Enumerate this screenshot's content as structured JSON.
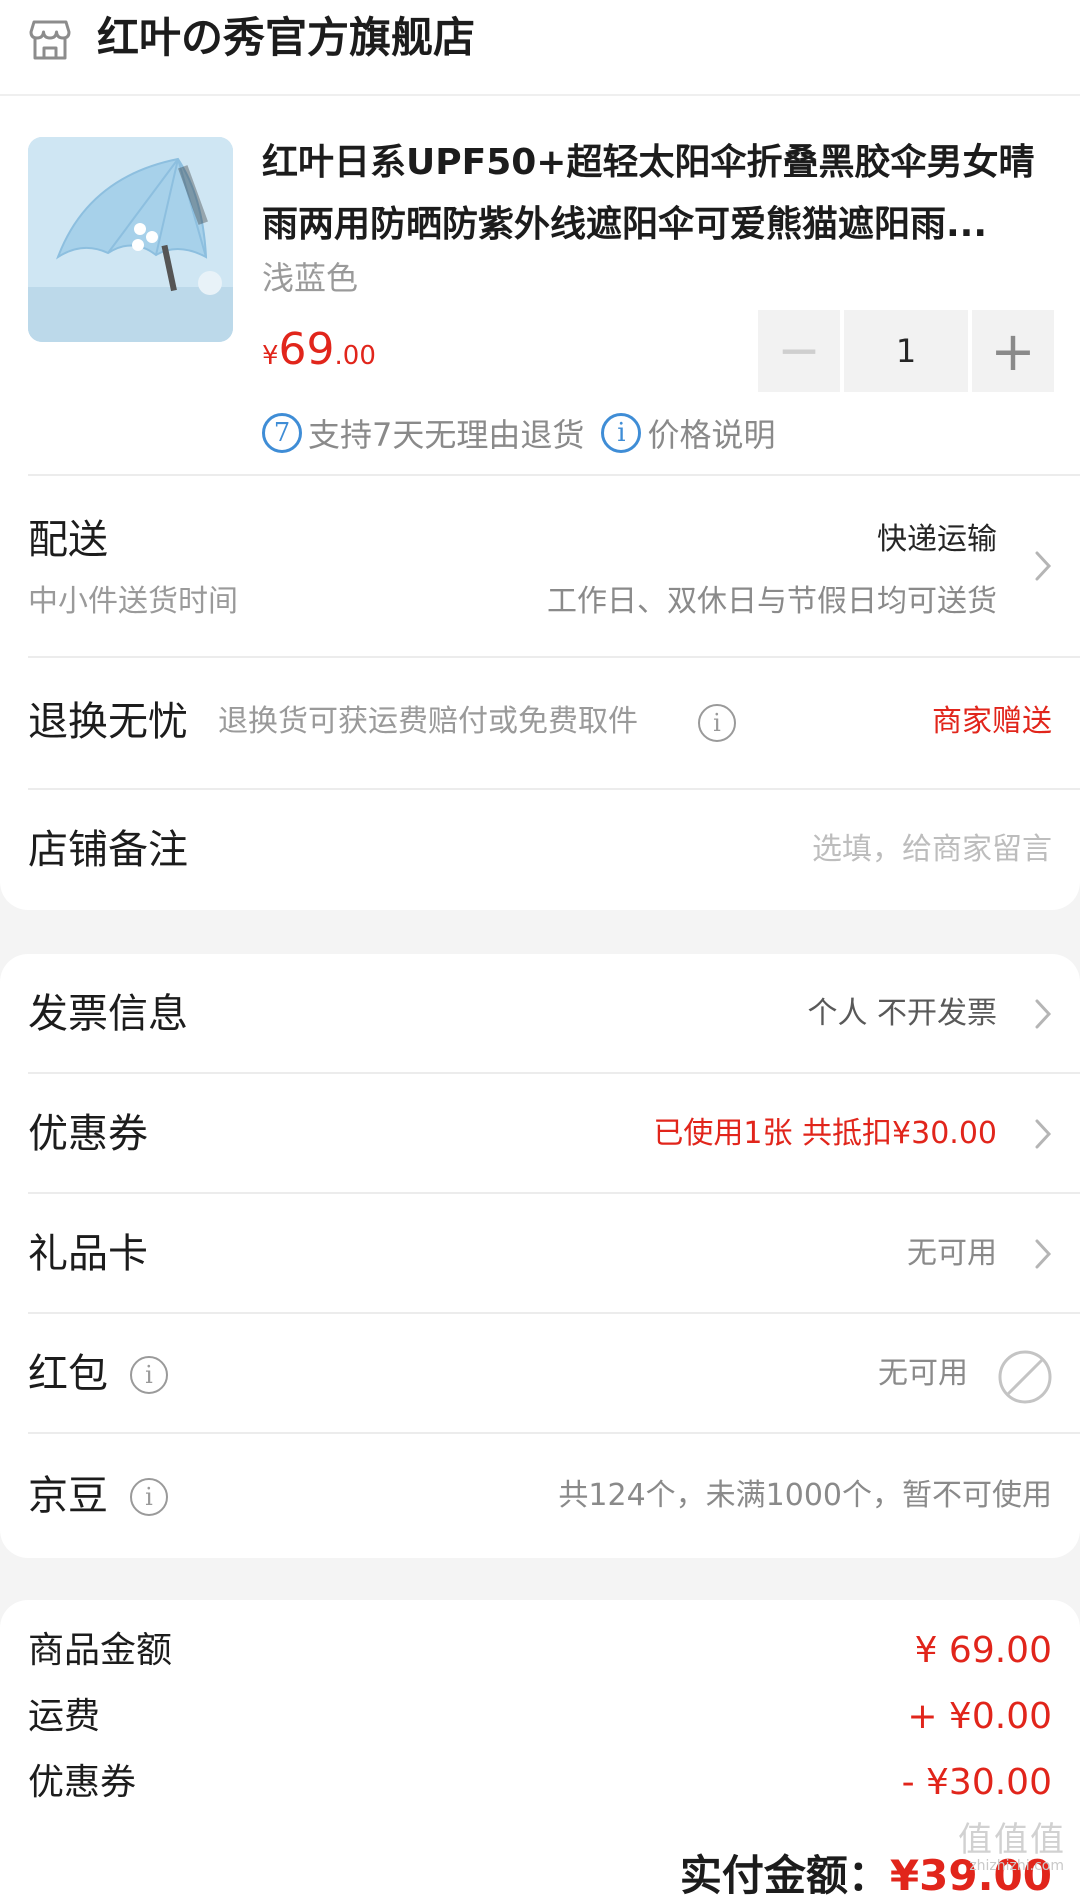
{
  "shop": {
    "name": "红叶の秀官方旗舰店",
    "icon": "store-icon"
  },
  "product": {
    "title_line1": "红叶日系UPF50+超轻太阳伞折叠黑胶伞男女晴",
    "title_line2": "雨两用防晒防紫外线遮阳伞可爱熊猫遮阳雨...",
    "variant": "浅蓝色",
    "price_currency": "¥",
    "price_int": "69",
    "price_dec": ".00",
    "quantity": "1",
    "minus": "−",
    "plus": "+",
    "tags": [
      {
        "icon_text": "7",
        "label": "支持7天无理由退货"
      },
      {
        "icon_text": "i",
        "label": "价格说明"
      }
    ]
  },
  "delivery": {
    "label": "配送",
    "method": "快递运输",
    "sub_label": "中小件送货时间",
    "sub_value": "工作日、双休日与节假日均可送货"
  },
  "return_service": {
    "label": "退换无忧",
    "desc": "退换货可获运费赔付或免费取件",
    "value": "商家赠送"
  },
  "note": {
    "label": "店铺备注",
    "placeholder": "选填，给商家留言"
  },
  "invoice": {
    "label": "发票信息",
    "value": "个人 不开发票"
  },
  "coupon": {
    "label": "优惠券",
    "value": "已使用1张 共抵扣¥30.00"
  },
  "gift_card": {
    "label": "礼品卡",
    "value": "无可用"
  },
  "red_packet": {
    "label": "红包",
    "value": "无可用"
  },
  "jingdou": {
    "label": "京豆",
    "value": "共124个，未满1000个，暂不可使用"
  },
  "summary": {
    "goods_label": "商品金额",
    "goods_value": "¥ 69.00",
    "shipping_label": "运费",
    "shipping_value": "+ ¥0.00",
    "coupon_label": "优惠券",
    "coupon_value": "- ¥30.00",
    "total_label": "实付金额：",
    "total_value": "¥39.00"
  },
  "watermark": "值值值",
  "watermark_sub": "zhizhizhi.com",
  "colors": {
    "accent_red": "#e1251b",
    "info_blue": "#3f8dd6",
    "background": "#f4f4f4"
  }
}
